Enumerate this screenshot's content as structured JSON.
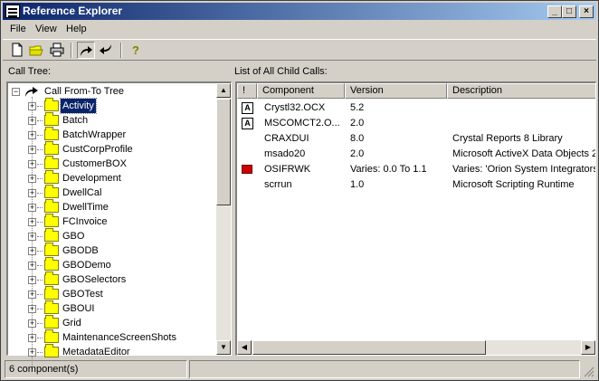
{
  "window": {
    "title": "Reference Explorer",
    "controls": [
      "_",
      "□",
      "×"
    ]
  },
  "menu": [
    "File",
    "View",
    "Help"
  ],
  "toolbar": {
    "buttons": [
      "new-icon",
      "open-icon",
      "print-icon",
      "call-from-icon",
      "call-to-icon",
      "help-icon"
    ]
  },
  "left_pane": {
    "label": "Call Tree:",
    "root": "Call From-To Tree",
    "items": [
      "Activity",
      "Batch",
      "BatchWrapper",
      "CustCorpProfile",
      "CustomerBOX",
      "Development",
      "DwellCal",
      "DwellTime",
      "FCInvoice",
      "GBO",
      "GBODB",
      "GBODemo",
      "GBOSelectors",
      "GBOTest",
      "GBOUI",
      "Grid",
      "MaintenanceScreenShots",
      "MetadataEditor"
    ],
    "selected": "Activity"
  },
  "right_pane": {
    "label": "List of All Child Calls:",
    "columns": [
      "!",
      "Component",
      "Version",
      "Description"
    ],
    "rows": [
      {
        "icon": "activex-icon",
        "component": "Crystl32.OCX",
        "version": "5.2",
        "description": ""
      },
      {
        "icon": "activex-icon",
        "component": "MSCOMCT2.O...",
        "version": "2.0",
        "description": ""
      },
      {
        "icon": "",
        "component": "CRAXDUI",
        "version": "8.0",
        "description": "Crystal Reports 8 Library"
      },
      {
        "icon": "",
        "component": "msado20",
        "version": "2.0",
        "description": "Microsoft ActiveX Data Objects 2"
      },
      {
        "icon": "book-icon",
        "component": "OSIFRWK",
        "version": "Varies: 0.0 To 1.1",
        "description": "Varies: 'Orion System Integrators"
      },
      {
        "icon": "",
        "component": "scrrun",
        "version": "1.0",
        "description": "Microsoft Scripting Runtime"
      }
    ]
  },
  "status": {
    "text": "6 component(s)",
    "secondary": ""
  }
}
